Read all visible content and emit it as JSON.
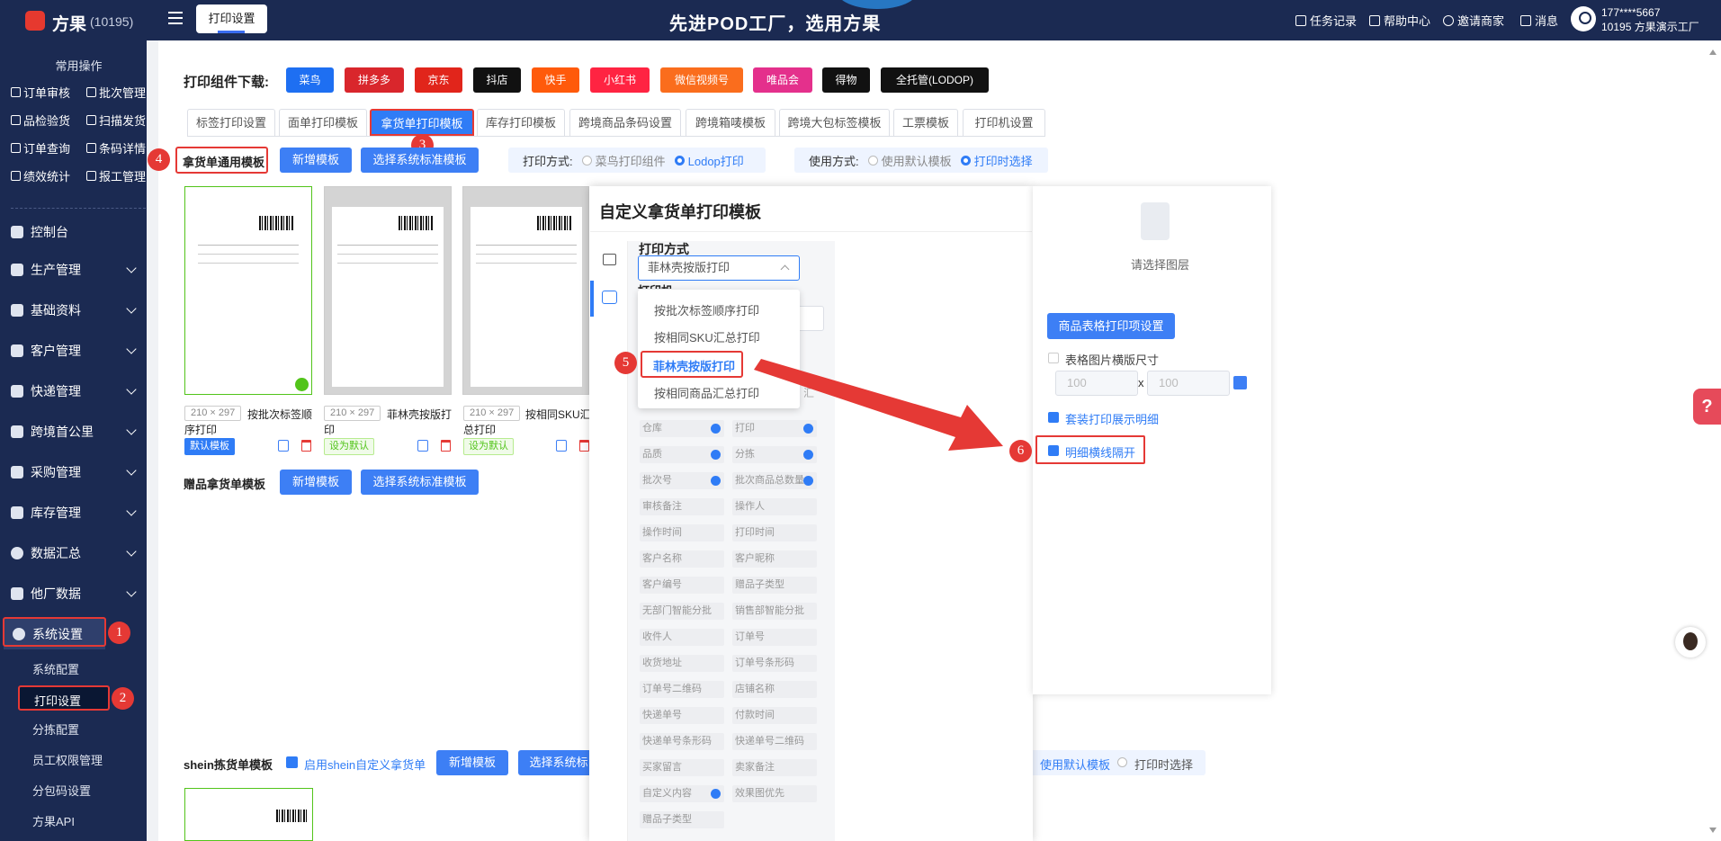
{
  "app": {
    "name": "方果",
    "id": "(10195)"
  },
  "topbar": {
    "tab": "打印设置",
    "slogan": "先进POD工厂，选用方果",
    "links": [
      "任务记录",
      "帮助中心",
      "邀请商家",
      "消息"
    ],
    "user_phone": "177****5667",
    "user_org": "10195 方果演示工厂"
  },
  "sidebar": {
    "common_title": "常用操作",
    "quick": [
      "订单审核",
      "批次管理",
      "品检验货",
      "扫描发货",
      "订单查询",
      "条码详情",
      "绩效统计",
      "报工管理"
    ],
    "nav": [
      "控制台",
      "生产管理",
      "基础资料",
      "客户管理",
      "快递管理",
      "跨境首公里",
      "采购管理",
      "库存管理",
      "数据汇总",
      "他厂数据",
      "系统设置"
    ],
    "sub": [
      "系统配置",
      "打印设置",
      "分拣配置",
      "员工权限管理",
      "分包码设置",
      "方果API"
    ]
  },
  "content": {
    "download_label": "打印组件下载:",
    "downloads": [
      "菜鸟",
      "拼多多",
      "京东",
      "抖店",
      "快手",
      "小红书",
      "微信视频号",
      "唯品会",
      "得物",
      "全托管(LODOP)"
    ],
    "tabs": [
      "标签打印设置",
      "面单打印模板",
      "拿货单打印模板",
      "库存打印模板",
      "跨境商品条码设置",
      "跨境箱唛模板",
      "跨境大包标签模板",
      "工票模板",
      "打印机设置"
    ],
    "general_label": "拿货单通用模板",
    "add_template": "新增模板",
    "choose_standard": "选择系统标准模板",
    "print_way_label": "打印方式:",
    "print_way_opts": [
      "菜鸟打印组件",
      "Lodop打印"
    ],
    "use_way_label": "使用方式:",
    "use_way_opts": [
      "使用默认模板",
      "打印时选择"
    ],
    "cards": [
      {
        "dim": "210 × 297",
        "name1": "按批次标签顺",
        "name2": "序打印",
        "tag": "默认模板"
      },
      {
        "dim": "210 × 297",
        "name1": "菲林壳按版打",
        "name2": "印",
        "tag": "设为默认"
      },
      {
        "dim": "210 × 297",
        "name1": "按相同SKU汇",
        "name2": "总打印",
        "tag": "设为默认"
      }
    ],
    "gift_label": "赠品拿货单模板",
    "shein_label": "shein拣货单模板",
    "shein_check": "启用shein自定义拿货单",
    "shein_choose": "选择系统标",
    "shein_opts": [
      "使用默认模板",
      "打印时选择"
    ]
  },
  "modal": {
    "title": "自定义拿货单打印模板",
    "print_method_label": "打印方式",
    "printer_cut": "打印机",
    "selected": "菲林壳按版打印",
    "options": [
      "按批次标签顺序打印",
      "按相同SKU汇总打印",
      "菲林壳按版打印",
      "按相同商品汇总打印"
    ],
    "behind_text": "汇",
    "fields": [
      [
        "仓库",
        true,
        "打印",
        true
      ],
      [
        "品质",
        true,
        "分拣",
        true
      ],
      [
        "批次号",
        true,
        "批次商品总数量",
        true
      ],
      [
        "审核备注",
        false,
        "操作人",
        false
      ],
      [
        "操作时间",
        false,
        "打印时间",
        false
      ],
      [
        "客户名称",
        false,
        "客户昵称",
        false
      ],
      [
        "客户编号",
        false,
        "赠品子类型",
        false
      ],
      [
        "无部门智能分批",
        false,
        "销售部智能分批",
        false
      ],
      [
        "收件人",
        false,
        "订单号",
        false
      ],
      [
        "收货地址",
        false,
        "订单号条形码",
        false
      ],
      [
        "订单号二维码",
        false,
        "店铺名称",
        false
      ],
      [
        "快递单号",
        false,
        "付款时间",
        false
      ],
      [
        "快递单号条形码",
        false,
        "快递单号二维码",
        false
      ],
      [
        "买家留言",
        false,
        "卖家备注",
        false
      ],
      [
        "自定义内容",
        true,
        "效果图优先",
        false
      ],
      [
        "赠品子类型",
        false,
        "",
        false
      ]
    ]
  },
  "right_panel": {
    "hint": "请选择图层",
    "btn": "商品表格打印项设置",
    "chk_size": "表格图片横版尺寸",
    "w": "100",
    "h": "100",
    "times": "x",
    "chk_set": "套装打印展示明细",
    "chk_line": "明细横线隔开"
  },
  "steps": [
    "1",
    "2",
    "3",
    "4",
    "5",
    "6"
  ],
  "colors": {
    "accent": "#2f7cf6",
    "highlight": "#e53935",
    "nav_bg": "#1b2a52"
  }
}
